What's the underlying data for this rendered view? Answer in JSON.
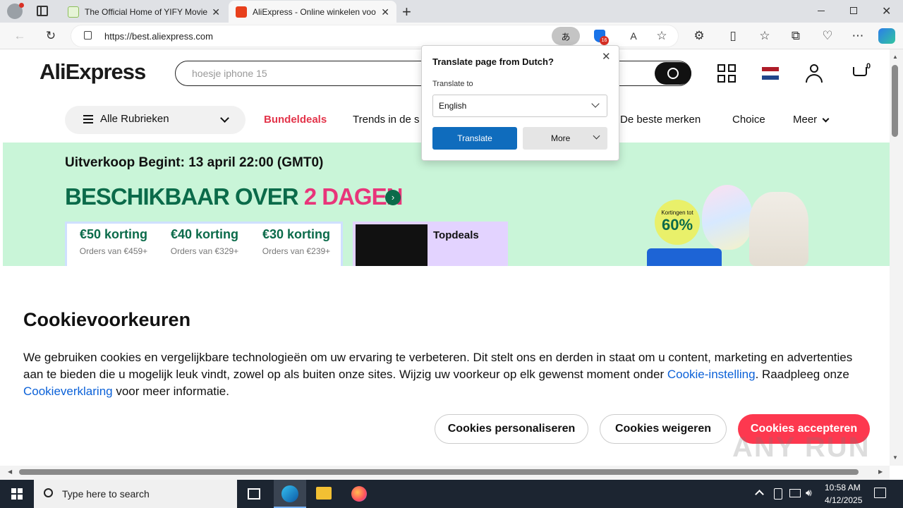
{
  "browser": {
    "tabs": [
      {
        "title": "The Official Home of YIFY Movie"
      },
      {
        "title": "AliExpress - Online winkelen voo"
      }
    ],
    "url": "https://best.aliexpress.com",
    "extension_badge": "16"
  },
  "site": {
    "logo": "AliExpress",
    "search_placeholder": "hoesje iphone 15",
    "cart_count": "0",
    "categories_label": "Alle Rubrieken",
    "nav": [
      "Bundeldeals",
      "Trends in de s",
      "De beste merken",
      "Choice",
      "Meer"
    ]
  },
  "banner": {
    "date": "Uitverkoop Begint: 13 april 22:00 (GMT0)",
    "headline_a": "BESCHIKBAAR OVER",
    "headline_b": "2 DAGEN",
    "coupons": [
      {
        "amount": "€50 korting",
        "sub": "Orders van €459+"
      },
      {
        "amount": "€40 korting",
        "sub": "Orders van €329+"
      },
      {
        "amount": "€30 korting",
        "sub": "Orders van €239+"
      }
    ],
    "topdeals": "Topdeals",
    "badge_small": "Kortingen tot",
    "badge_big": "60%"
  },
  "cookie": {
    "title": "Cookievoorkeuren",
    "body_1": "We gebruiken cookies en vergelijkbare technologieën om uw ervaring te verbeteren. Dit stelt ons en derden in staat om u content, marketing en advertenties aan te bieden die u mogelijk leuk vindt, zowel op als buiten onze sites. Wijzig uw voorkeur op elk gewenst moment onder ",
    "link_1": "Cookie-instelling",
    "body_2": ". Raadpleeg onze ",
    "link_2": "Cookieverklaring",
    "body_3": " voor meer informatie.",
    "btn_personalize": "Cookies personaliseren",
    "btn_reject": "Cookies weigeren",
    "btn_accept": "Cookies accepteren"
  },
  "translate_popup": {
    "title": "Translate page from Dutch?",
    "label": "Translate to",
    "selected": "English",
    "translate_btn": "Translate",
    "more_btn": "More"
  },
  "taskbar": {
    "search_placeholder": "Type here to search",
    "time": "10:58 AM",
    "date": "4/12/2025"
  },
  "watermark": "ANY RUN"
}
